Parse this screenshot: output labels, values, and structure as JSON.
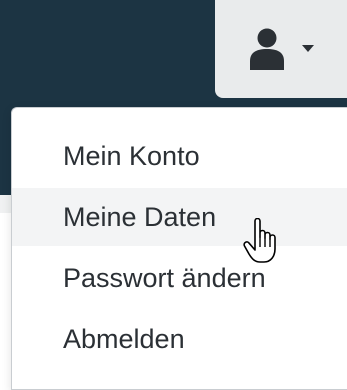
{
  "navbar": {
    "background_color": "#1c3443",
    "user_menu": {
      "icon": "user-icon",
      "caret": "caret-down-icon",
      "background_color": "#e9ebec"
    }
  },
  "dropdown": {
    "items": [
      {
        "label": "Mein Konto"
      },
      {
        "label": "Meine Daten",
        "hovered": true
      },
      {
        "label": "Passwort ändern"
      },
      {
        "label": "Abmelden"
      }
    ]
  },
  "cursor": {
    "icon": "pointer-hand-icon"
  }
}
